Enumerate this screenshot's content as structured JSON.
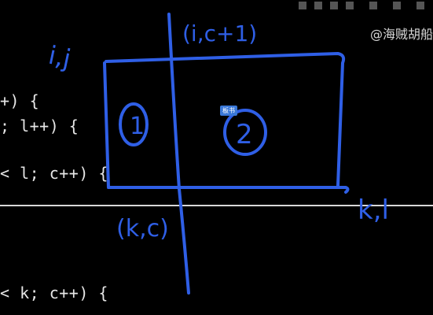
{
  "code": {
    "lines": [
      "+) {",
      "; l++) {",
      "< l; c++) {",
      "< k; c++) {"
    ]
  },
  "watermark": "@海贼胡船",
  "badge": "板书",
  "annotations": {
    "top_left_label": "i,j",
    "top_right_label": "(i,c+1)",
    "bottom_left_label": "(k,c)",
    "bottom_right_label": "k,l",
    "region_1": "1",
    "region_2": "2"
  },
  "colors": {
    "ink": "#2f5fe6",
    "background": "#000000",
    "code_text": "#e6e6e6"
  }
}
